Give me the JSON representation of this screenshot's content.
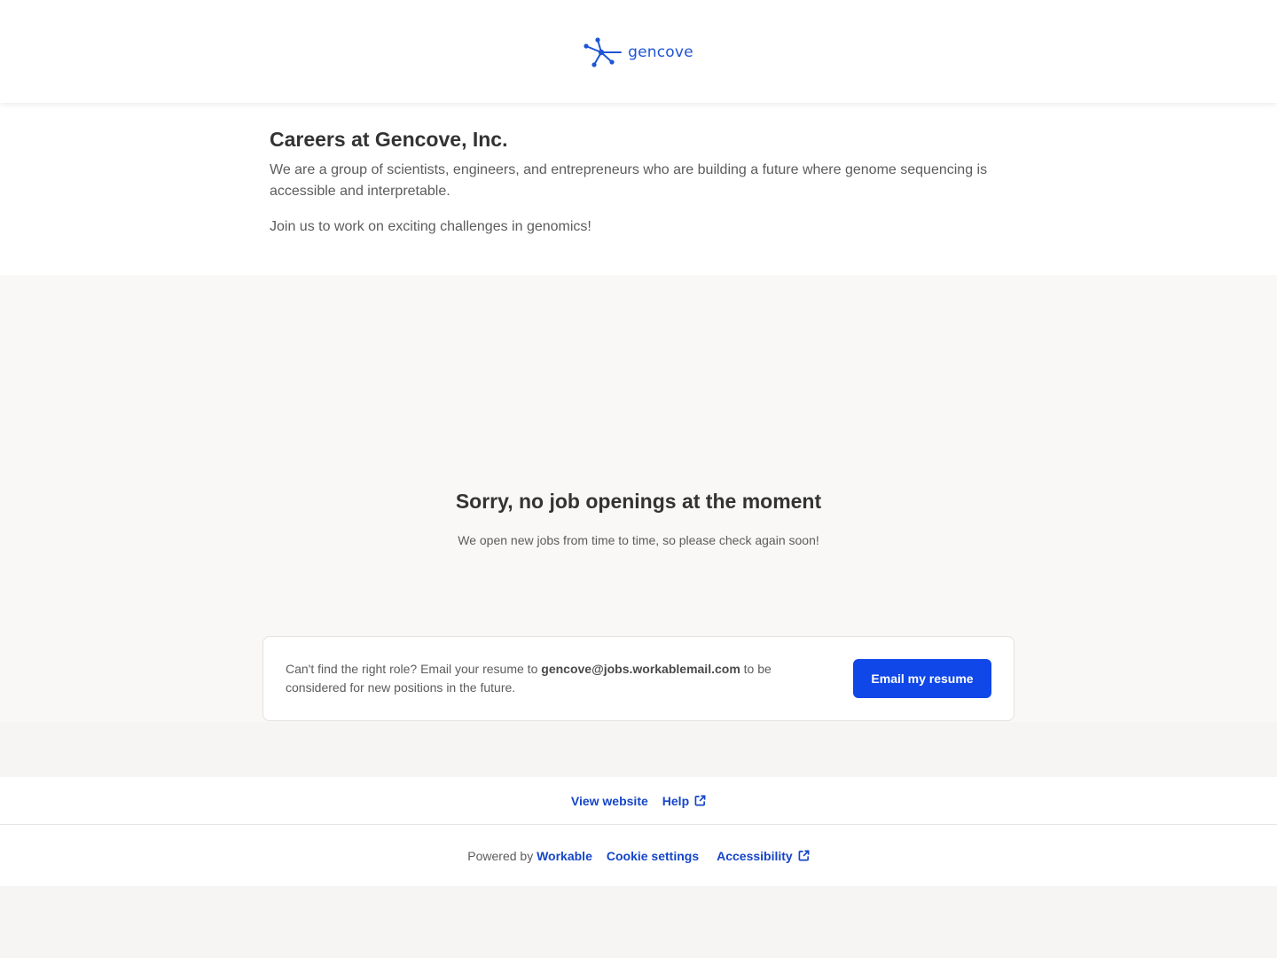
{
  "header": {
    "logo_text": "gencove",
    "brand_color": "#1e55d6",
    "logo_icon": "molecule-icon"
  },
  "intro": {
    "title": "Careers at Gencove, Inc.",
    "description": "We are a group of scientists, engineers, and entrepreneurs who are building a future where genome sequencing is accessible and interpretable.",
    "tagline": "Join us to work on exciting challenges in genomics!"
  },
  "empty_state": {
    "title": "Sorry, no job openings at the moment",
    "subtitle": "We open new jobs from time to time, so please check again soon!"
  },
  "resume": {
    "text_before": "Can't find the right role? Email your resume to ",
    "email": "gencove@jobs.workablemail.com",
    "text_after": " to be considered for new positions in the future.",
    "button_label": "Email my resume",
    "button_color": "#0f47e8"
  },
  "footer": {
    "view_website": "View website",
    "help": "Help",
    "powered_by": "Powered by",
    "workable": "Workable",
    "cookie_settings": "Cookie settings",
    "accessibility": "Accessibility",
    "external_icon": "external-link-icon",
    "link_color": "#1546c8"
  }
}
